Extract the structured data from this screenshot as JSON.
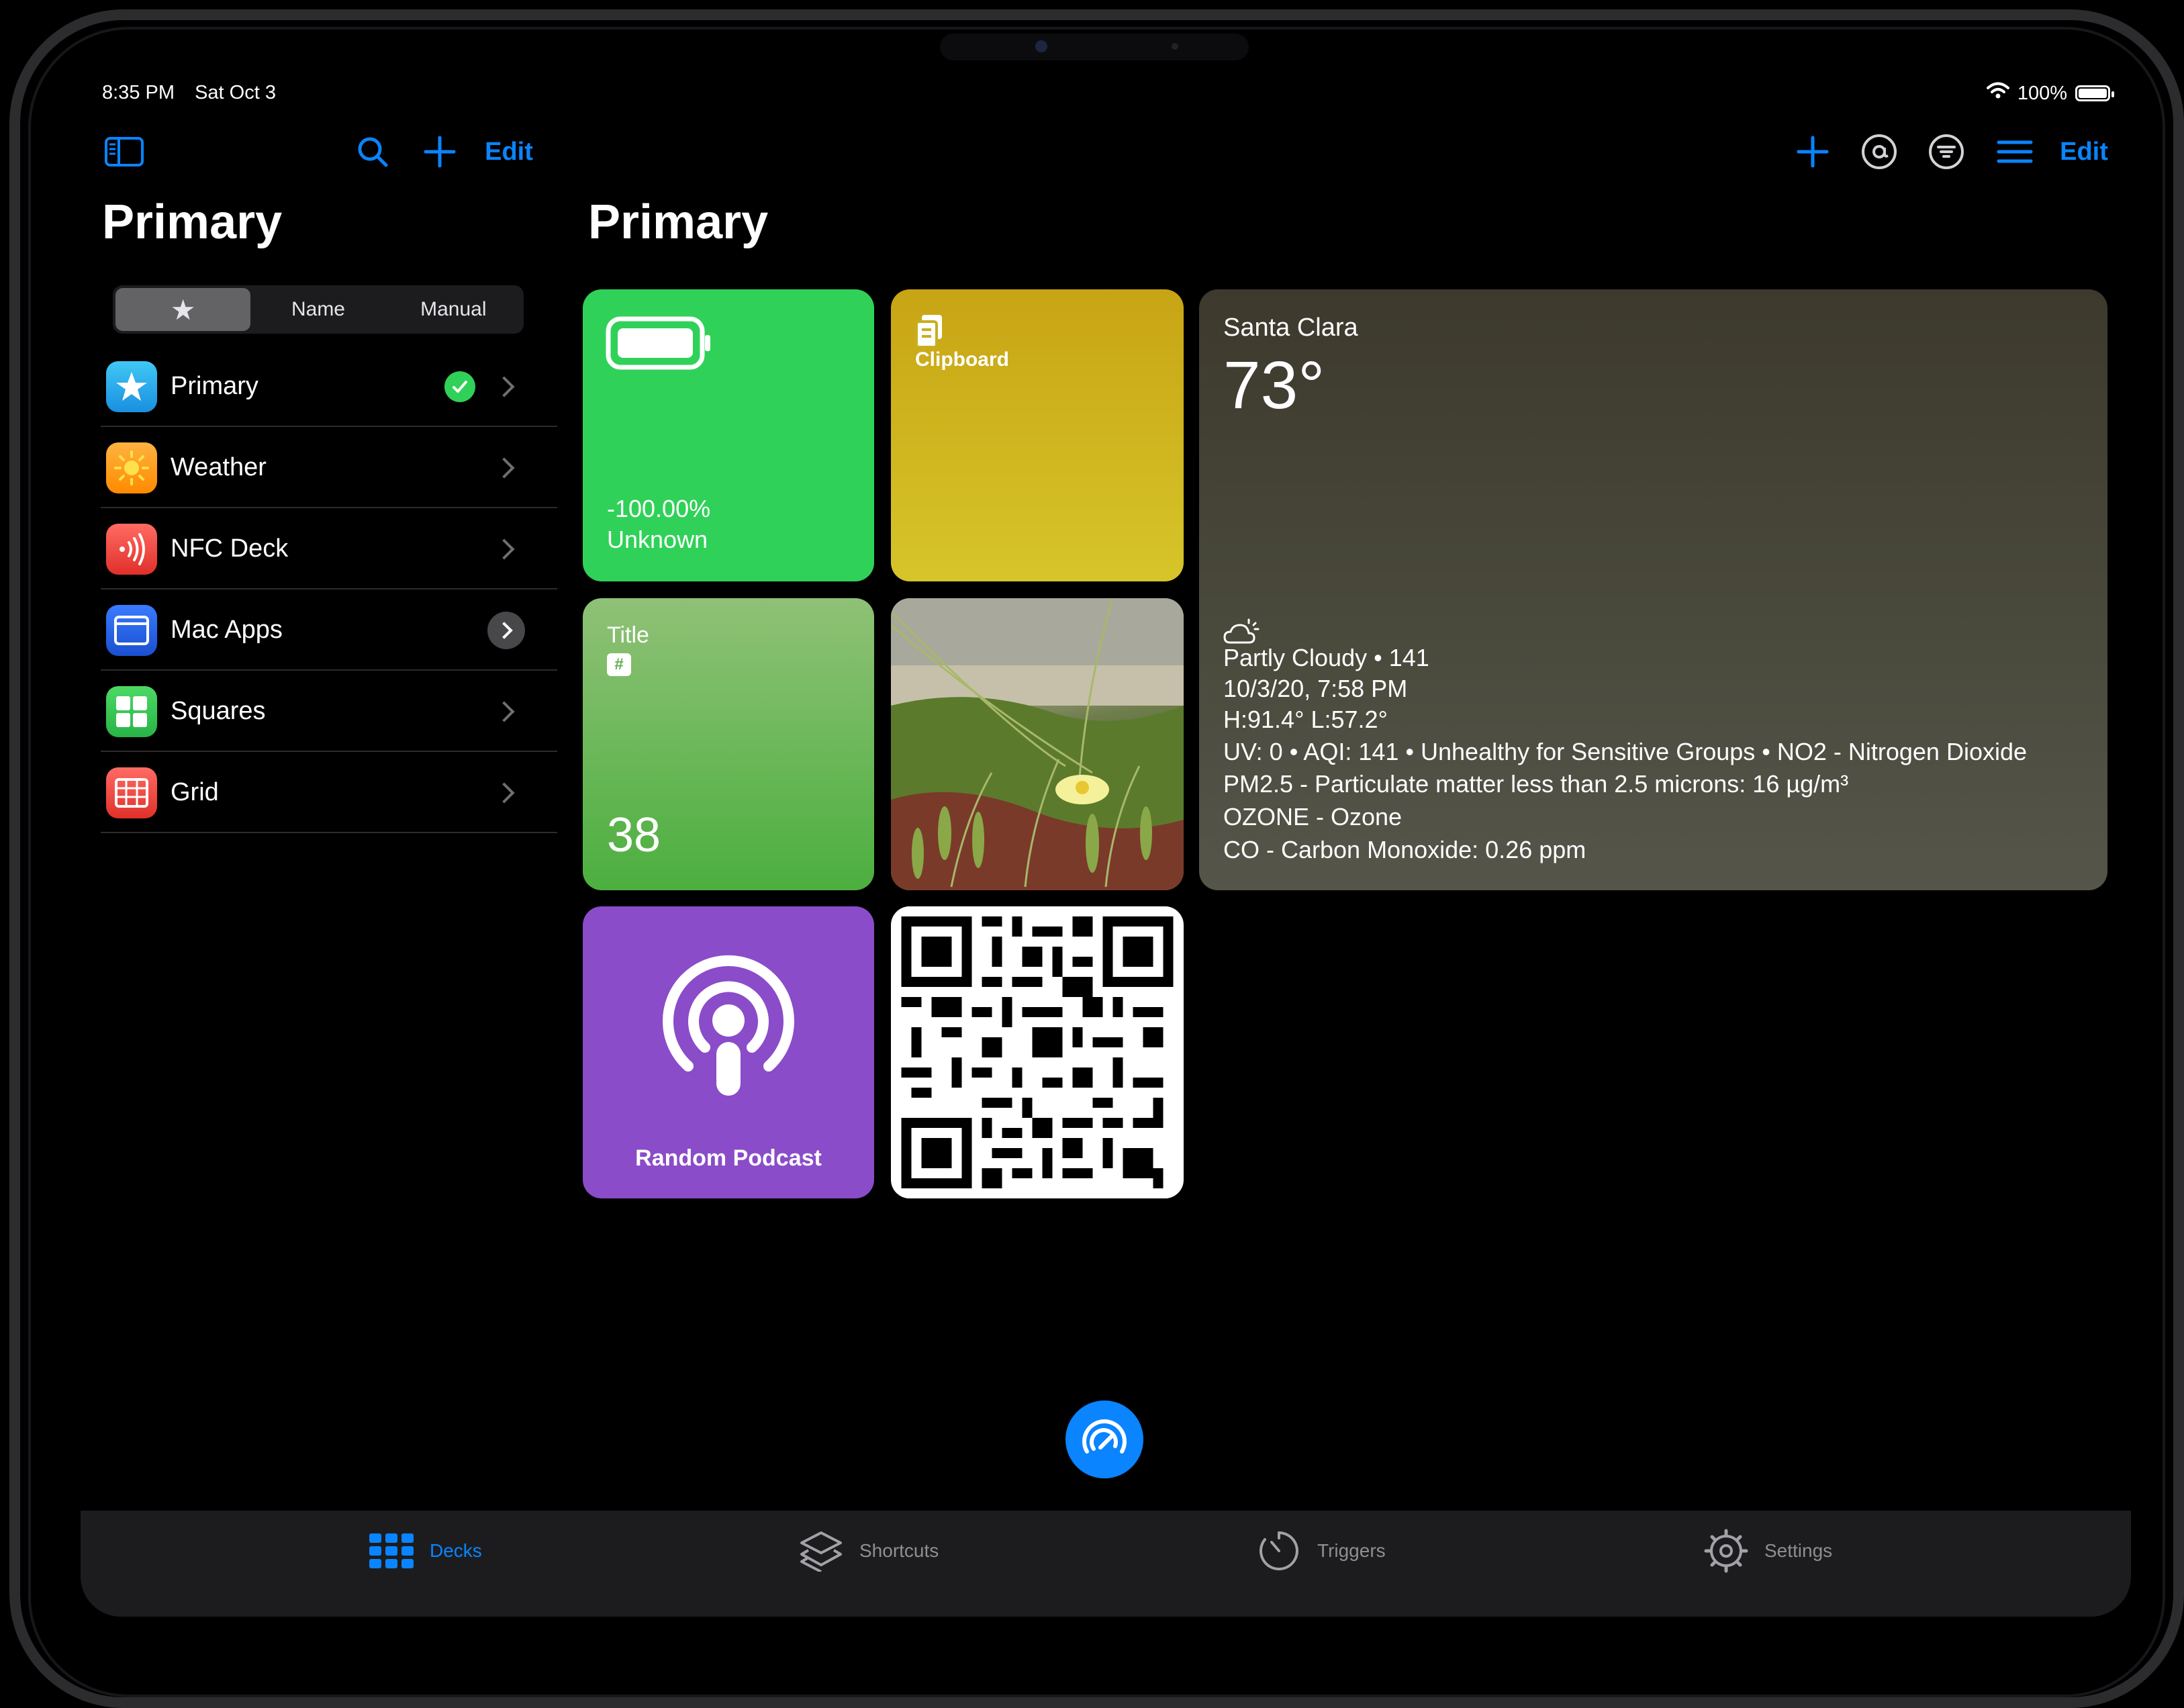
{
  "status_bar": {
    "time": "8:35 PM",
    "date": "Sat Oct 3",
    "battery": "100%"
  },
  "sidebar": {
    "nav": {
      "edit_label": "Edit"
    },
    "title": "Primary",
    "segments": [
      {
        "label": "★",
        "active": true
      },
      {
        "label": "Name",
        "active": false
      },
      {
        "label": "Manual",
        "active": false
      }
    ],
    "items": [
      {
        "label": "Primary",
        "icon": "star-icon",
        "color": "#20a4f3",
        "selected": true
      },
      {
        "label": "Weather",
        "icon": "sun-icon",
        "color": "#ff9f0a"
      },
      {
        "label": "NFC Deck",
        "icon": "nfc-icon",
        "color": "#ff453a"
      },
      {
        "label": "Mac Apps",
        "icon": "window-icon",
        "color": "#0a60ff",
        "info": true
      },
      {
        "label": "Squares",
        "icon": "squares-icon",
        "color": "#30d158"
      },
      {
        "label": "Grid",
        "icon": "grid-icon",
        "color": "#ff453a"
      }
    ]
  },
  "main": {
    "nav": {
      "edit_label": "Edit"
    },
    "title": "Primary",
    "tiles": {
      "battery": {
        "percent": "-100.00%",
        "state": "Unknown"
      },
      "clipboard": {
        "label": "Clipboard"
      },
      "weather": {
        "city": "Santa Clara",
        "temp": "73°",
        "condition": "Partly Cloudy • 141",
        "updated": "10/3/20, 7:58 PM",
        "hilo": "H:91.4° L:57.2°",
        "uv": "UV: 0 • AQI: 141 • Unhealthy for Sensitive Groups • NO2 - Nitrogen Dioxide",
        "pm25": "PM2.5 - Particulate matter less than 2.5 microns: 16 µg/m³",
        "ozone": "OZONE - Ozone",
        "co": "CO - Carbon Monoxide: 0.26 ppm"
      },
      "title_tile": {
        "title": "Title",
        "badge": "#",
        "value": "38"
      },
      "podcast": {
        "label": "Random Podcast"
      }
    }
  },
  "tabbar": {
    "tabs": [
      {
        "label": "Decks",
        "icon": "grid-icon",
        "active": true
      },
      {
        "label": "Shortcuts",
        "icon": "shortcuts-icon",
        "active": false
      },
      {
        "label": "Triggers",
        "icon": "timer-icon",
        "active": false
      },
      {
        "label": "Settings",
        "icon": "gear-icon",
        "active": false
      }
    ]
  },
  "colors": {
    "accent": "#0a84ff",
    "background": "#000000",
    "battery_tile": "#30d158",
    "podcast_tile": "#8a4cc9"
  }
}
